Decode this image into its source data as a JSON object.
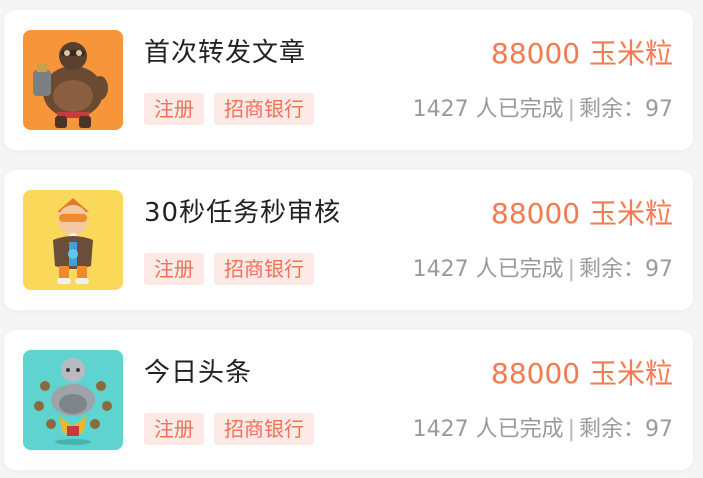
{
  "tasks": [
    {
      "title": "首次转发文章",
      "reward": "88000 玉米粒",
      "tags": [
        "注册",
        "招商银行"
      ],
      "completed": "1427 人已完成",
      "separator": "|",
      "remaining": "剩余：97",
      "thumb": {
        "icon": "armored-heavy-character-icon",
        "bg": "#f7953b"
      }
    },
    {
      "title": "30秒任务秒审核",
      "reward": "88000 玉米粒",
      "tags": [
        "注册",
        "招商银行"
      ],
      "completed": "1427 人已完成",
      "separator": "|",
      "remaining": "剩余：97",
      "thumb": {
        "icon": "goggles-pilot-character-icon",
        "bg": "#fad95a"
      }
    },
    {
      "title": "今日头条",
      "reward": "88000 玉米粒",
      "tags": [
        "注册",
        "招商银行"
      ],
      "completed": "1427 人已完成",
      "separator": "|",
      "remaining": "剩余：97",
      "thumb": {
        "icon": "meditating-robot-monk-icon",
        "bg": "#5fd3cf"
      }
    }
  ],
  "colors": {
    "accent": "#f47a4f",
    "tag_bg": "#fde9e6",
    "tag_text": "#f0705a",
    "title": "#222222",
    "muted": "#9a9a9a"
  }
}
